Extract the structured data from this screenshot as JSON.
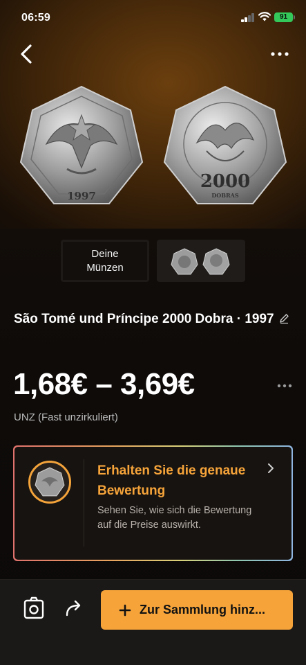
{
  "status_bar": {
    "time": "06:59",
    "battery": "91"
  },
  "thumbnails": {
    "your_coins_label": "Deine Münzen"
  },
  "coin": {
    "title": "São Tomé und Príncipe 2000 Dobra · 1997",
    "left_face_year": "1997",
    "right_face_value": "2000",
    "right_face_unit": "DOBRAS"
  },
  "price": {
    "range": "1,68€ – 3,69€",
    "grade": "UNZ (Fast unzirkuliert)"
  },
  "valuation_card": {
    "title": "Erhalten Sie die genaue Bewertung",
    "text": "Sehen Sie, wie sich die Bewertung auf die Preise auswirkt."
  },
  "bottom_bar": {
    "add_button_label": "Zur Sammlung hinz..."
  },
  "colors": {
    "accent": "#f6a43a",
    "battery": "#34c759",
    "background": "#0d0a08"
  },
  "icons": [
    "chevron-left-icon",
    "more-icon",
    "edit-icon",
    "chevron-right-icon",
    "camera-icon",
    "share-icon",
    "plus-icon"
  ]
}
